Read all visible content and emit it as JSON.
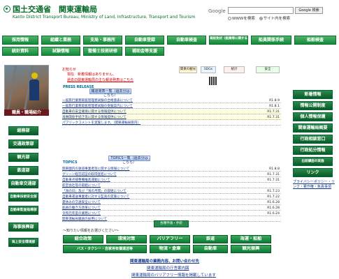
{
  "header": {
    "title": "国土交通省　関東運輸局",
    "subtitle": "Kanto District Transport Bureau, Ministry of Land, Infrastructure, Transport and Tourism",
    "google_label": "Google",
    "search_value": "",
    "search_button": "Google 検索",
    "radio_www": "WWWを検索",
    "radio_site": "サイト内を検索"
  },
  "nav_row1": [
    "採用情報",
    "組織と業務",
    "支局・事務所",
    "自動車登録",
    "自動車検査",
    "海技免状（船員等に関する）",
    "船員関係手続",
    "船舶検査"
  ],
  "nav_row2": [
    "統計資料",
    "試験情報",
    "整備士技術研修",
    "補助金等支援"
  ],
  "left": {
    "photo_caption": "職員・職場紹介",
    "buttons": [
      "総務部",
      "交通政策部",
      "観光部",
      "鉄道部",
      "自動車交通部",
      "自動車技術安全部",
      "自動車監査指導部",
      "海事振興部",
      "海上安全環境部"
    ]
  },
  "center": {
    "date_line": "お知らせ",
    "notices": [
      "現在　新着情報はありません。",
      "過去の関東運輸局の主な報道発表はこちら"
    ],
    "banners": [
      "関東の観光",
      "SDGs",
      "統計",
      "安全"
    ],
    "press_label": "PRESS RELEASE",
    "press_bar": "報道発表一覧（過去分はこちら）",
    "press": [
      {
        "t": "一般旅行業務取扱管理者試験の合格発表について",
        "d": "R1.8.9"
      },
      {
        "t": "一般旅行業務取扱管理者試験の受験案内について",
        "d": "R1.8.1"
      },
      {
        "t": "自動車の安全確保に関する情報提供について",
        "d": "R1.7.31"
      },
      {
        "t": "海事関係手続き等に関する情報提供について",
        "d": "R1.7.31"
      },
      {
        "t": "パブリックコメントを実施します。（関東運輸局管内）",
        "d": ""
      }
    ],
    "topics_label": "TOPICS",
    "topics_bar": "TOPICS一覧（過去分はこちら）",
    "topics": [
      {
        "t": "関東圏内の鉄道事業者等に関する情報について",
        "d": "R1.8.8"
      },
      {
        "t": "グリーン経営認証の取得促進について",
        "d": "R1.7.31"
      },
      {
        "t": "自動車点検整備推進運動について",
        "d": "R1.7.31"
      },
      {
        "t": "航空会社等の取組について",
        "d": ""
      },
      {
        "t": "「海の日」及び「海の月間」の取組について",
        "d": "R1.7.23"
      },
      {
        "t": "自動車運送事業者に対する監査の実施について",
        "d": "R1.7.22"
      },
      {
        "t": "夏休みの交通安全について",
        "d": "R1.6.28"
      },
      {
        "t": "船員の働き方改革について",
        "d": "R1.6.28"
      },
      {
        "t": "令和元年度の業務について",
        "d": "R1.6.24"
      },
      {
        "t": "関東運輸局職員の採用について",
        "d": ""
      }
    ],
    "category_label": "〜知りたい情報をお選びください〜",
    "category_box": "各種申請・手続",
    "categories_row1": [
      "総合政策",
      "環境対策",
      "バリアフリー",
      "鉄道",
      "海運・船舶"
    ],
    "categories_row2": [
      "バス・タクシー・自家用有償運送等",
      "物流・倉庫",
      "自動車",
      "観光振興"
    ],
    "bottom_links": [
      "関東運輸局の業務内容、お問い合わせ先",
      "関東運輸局の庁舎案内図",
      "関東運輸局のバリアフリー情報を掲載しています"
    ]
  },
  "right": {
    "buttons": [
      "新着情報",
      "情報公開制度",
      "個人情報保護",
      "関東運輸局概要",
      "行政相談窓口",
      "行政処分情報",
      "出前講座の実施",
      "リンク"
    ],
    "links": "プライバシーポリシー・リンク・著作権・免責事項"
  },
  "colors": {
    "brand_green": "#128a3a",
    "notice_red": "#cc0000",
    "link_blue": "#1a3a8a"
  }
}
